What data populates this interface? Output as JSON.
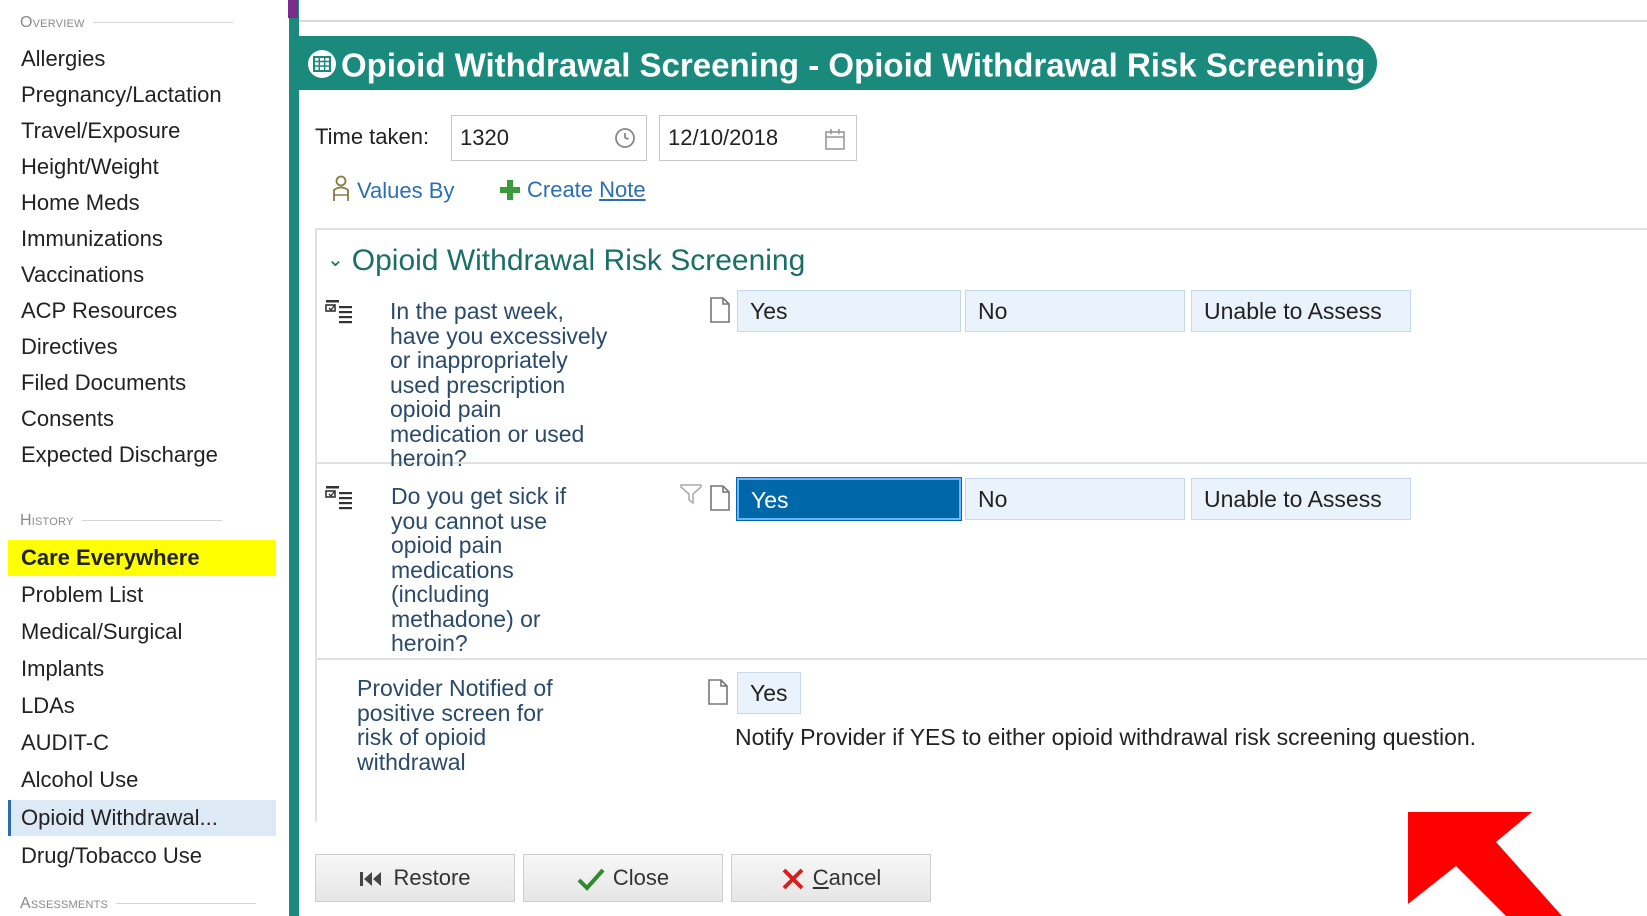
{
  "sidebar": {
    "sections": {
      "overview": "Overview",
      "history": "History",
      "assessments": "Assessments"
    },
    "items": [
      {
        "label": "Allergies"
      },
      {
        "label": "Pregnancy/Lactation"
      },
      {
        "label": "Travel/Exposure"
      },
      {
        "label": "Height/Weight"
      },
      {
        "label": "Home Meds"
      },
      {
        "label": "Immunizations"
      },
      {
        "label": "Vaccinations"
      },
      {
        "label": "ACP Resources"
      },
      {
        "label": "Directives"
      },
      {
        "label": "Filed Documents"
      },
      {
        "label": "Consents"
      },
      {
        "label": "Expected Discharge"
      },
      {
        "label": "Care Everywhere"
      },
      {
        "label": "Problem List"
      },
      {
        "label": "Medical/Surgical"
      },
      {
        "label": "Implants"
      },
      {
        "label": "LDAs"
      },
      {
        "label": "AUDIT-C"
      },
      {
        "label": "Alcohol Use"
      },
      {
        "label": "Opioid Withdrawal..."
      },
      {
        "label": "Drug/Tobacco Use"
      }
    ]
  },
  "header": {
    "title": "Opioid Withdrawal Screening - Opioid Withdrawal Risk Screening"
  },
  "time_taken": {
    "label": "Time taken:",
    "time_value": "1320",
    "date_value": "12/10/2018"
  },
  "links": {
    "values_by": "Values By",
    "create_note_prefix": "Create ",
    "create_note_underlined": "Note"
  },
  "section": {
    "title": "Opioid Withdrawal Risk Screening"
  },
  "questions": [
    {
      "text": "In the past week,\nhave you excessively\nor inappropriately\nused prescription\nopioid pain\nmedication or used\nheroin?",
      "options": [
        "Yes",
        "No",
        "Unable to Assess"
      ],
      "selected": null
    },
    {
      "text": "Do you get sick if\nyou cannot use\nopioid pain\nmedications\n(including\nmethadone) or\nheroin?",
      "options": [
        "Yes",
        "No",
        "Unable to Assess"
      ],
      "selected": "Yes"
    }
  ],
  "provider_notified": {
    "text": "Provider Notified of\npositive screen for\nrisk of opioid\nwithdrawal",
    "option": "Yes",
    "note": "Notify Provider if YES to either opioid withdrawal risk screening question."
  },
  "buttons": {
    "restore": "Restore",
    "close": "Close",
    "cancel_underlined": "C",
    "cancel_rest": "ancel"
  },
  "colors": {
    "accent": "#1a8a7c",
    "selected": "#0068a8",
    "highlight": "#ffff00",
    "link": "#2a6fb5",
    "arrow": "#ff0000"
  }
}
